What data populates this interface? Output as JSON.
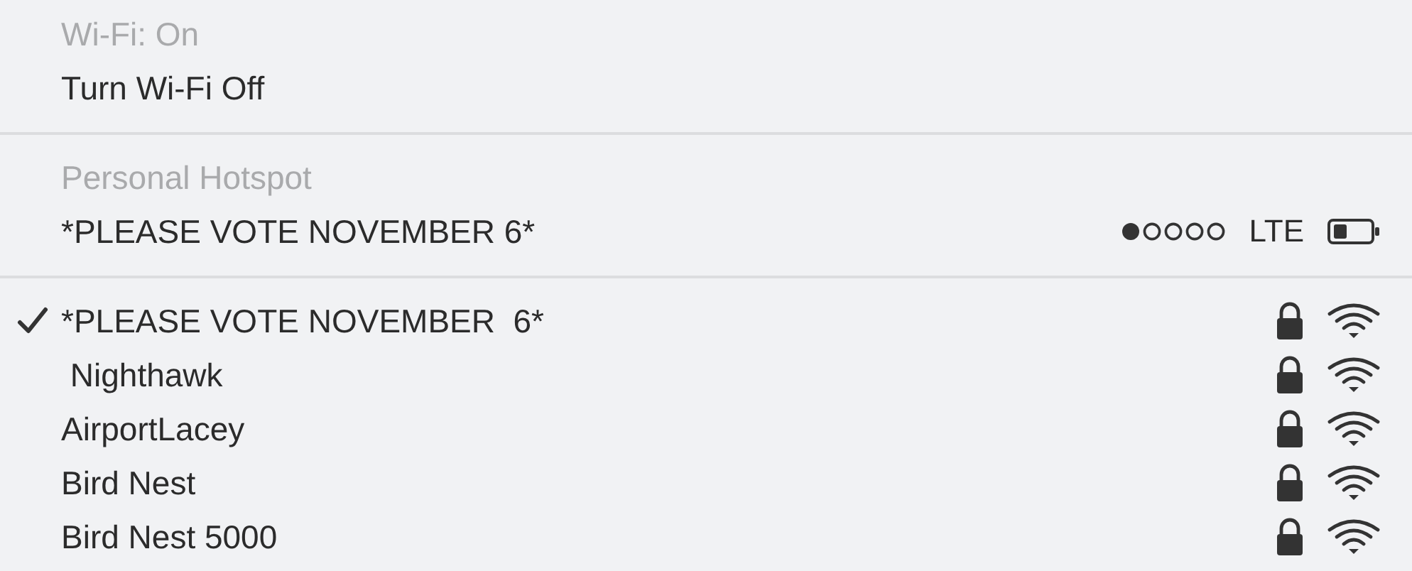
{
  "wifi_section": {
    "status": "Wi-Fi: On",
    "toggle": "Turn Wi-Fi Off"
  },
  "hotspot_section": {
    "heading": "Personal Hotspot",
    "device": {
      "name": "*PLEASE VOTE NOVEMBER 6*",
      "network": "LTE"
    }
  },
  "networks": [
    {
      "name": "*PLEASE VOTE NOVEMBER  6*",
      "selected": true,
      "locked": true
    },
    {
      "name": " Nighthawk",
      "selected": false,
      "locked": true
    },
    {
      "name": "AirportLacey",
      "selected": false,
      "locked": true
    },
    {
      "name": "Bird Nest",
      "selected": false,
      "locked": true
    },
    {
      "name": "Bird Nest 5000",
      "selected": false,
      "locked": true
    }
  ]
}
